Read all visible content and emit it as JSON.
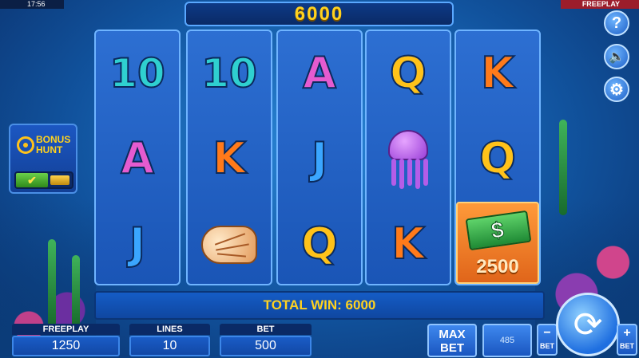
{
  "status": {
    "clock": "17:56",
    "mode": "FREEPLAY"
  },
  "win_display": "6000",
  "reels": [
    [
      "10",
      "A",
      "J"
    ],
    [
      "10",
      "K",
      "shell"
    ],
    [
      "A",
      "J",
      "Q"
    ],
    [
      "Q",
      "jellyfish",
      "K"
    ],
    [
      "K",
      "Q",
      "money"
    ]
  ],
  "money_symbol": {
    "value": "2500",
    "icon": "dollar-bill-icon"
  },
  "bonus_hunt": {
    "line1": "BONUS",
    "line2": "HUNT",
    "on_mark": "✔"
  },
  "side_buttons": {
    "help": "?",
    "sound": "🔈",
    "settings": "⚙"
  },
  "total_win": "TOTAL WIN: 6000",
  "bottom": {
    "balance_label": "FREEPLAY",
    "balance_value": "1250",
    "lines_label": "LINES",
    "lines_value": "10",
    "bet_label": "BET",
    "bet_value": "500",
    "max_bet_line1": "MAX",
    "max_bet_line2": "BET",
    "autoplay_count": "485",
    "bet_minus": "−",
    "bet_plus": "+",
    "bet_word": "BET",
    "spin_icon": "⟳"
  },
  "colors": {
    "accent": "#ffd21f",
    "panel": "#1a5cc6",
    "money": "#e0651a"
  }
}
